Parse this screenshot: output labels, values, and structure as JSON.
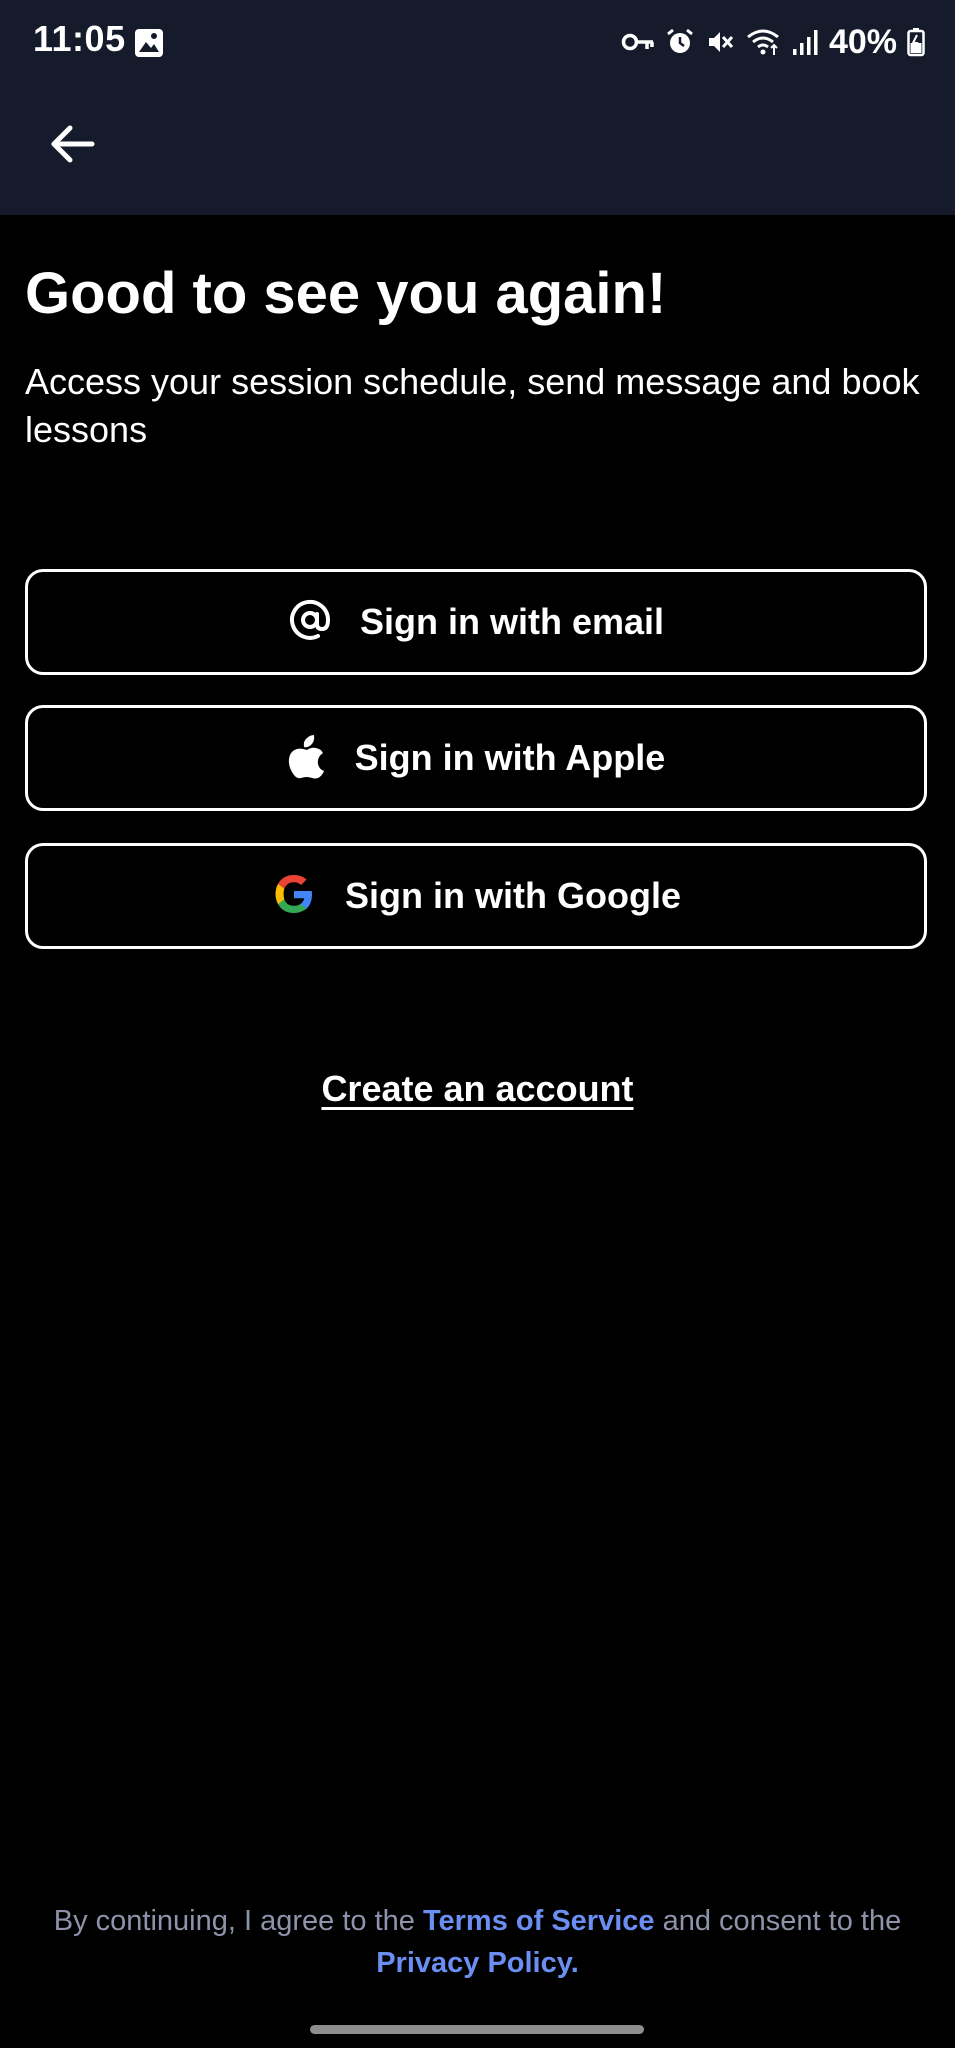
{
  "status_bar": {
    "time": "11:05",
    "battery": "40%",
    "icons": [
      "gallery-icon",
      "vpn-key-icon",
      "alarm-icon",
      "mute-icon",
      "wifi-icon",
      "signal-icon",
      "battery-icon"
    ]
  },
  "app_bar": {
    "back_icon": "arrow-left-icon"
  },
  "main": {
    "title": "Good to see you again!",
    "subtitle": "Access your session schedule, send message and book lessons"
  },
  "buttons": {
    "email": {
      "label": "Sign in with email",
      "icon": "at-sign-icon"
    },
    "apple": {
      "label": "Sign in with Apple",
      "icon": "apple-icon"
    },
    "google": {
      "label": "Sign in with Google",
      "icon": "google-icon"
    }
  },
  "create_account": "Create an account",
  "legal": {
    "prefix": "By continuing, I agree to the ",
    "terms": "Terms of Service",
    "middle": " and consent to the ",
    "privacy": "Privacy Policy",
    "suffix": "."
  },
  "colors": {
    "background": "#000000",
    "header_background": "#161b2b",
    "link": "#6b8ef2",
    "muted_text": "#8d93aa"
  }
}
